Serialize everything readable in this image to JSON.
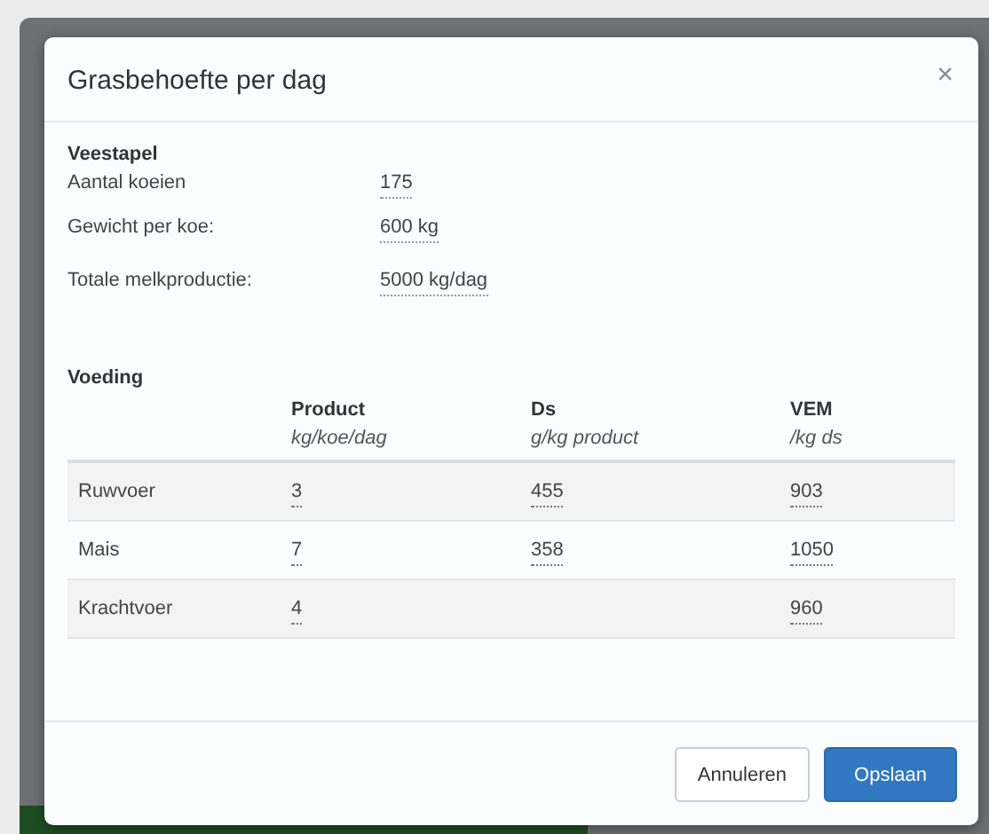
{
  "dialog": {
    "title": "Grasbehoefte per dag",
    "close": "×"
  },
  "livestock": {
    "heading": "Veestapel",
    "fields": [
      {
        "label": "Aantal koeien",
        "value": "175"
      },
      {
        "label": "Gewicht per koe:",
        "value": "600 kg"
      },
      {
        "label": "Totale melkproductie:",
        "value": "5000 kg/dag"
      }
    ]
  },
  "feeding": {
    "heading": "Voeding",
    "columns": [
      {
        "title": "Product",
        "unit": "kg/koe/dag"
      },
      {
        "title": "Ds",
        "unit": "g/kg product"
      },
      {
        "title": "VEM",
        "unit": "/kg ds"
      }
    ],
    "rows": [
      {
        "name": "Ruwvoer",
        "cells": [
          "3",
          "455",
          "903"
        ]
      },
      {
        "name": "Mais",
        "cells": [
          "7",
          "358",
          "1050"
        ]
      },
      {
        "name": "Krachtvoer",
        "cells": [
          "4",
          null,
          "960"
        ]
      }
    ]
  },
  "buttons": [
    {
      "label": "Annuleren",
      "kind": "secondary"
    },
    {
      "label": "Opslaan",
      "kind": "primary"
    }
  ]
}
